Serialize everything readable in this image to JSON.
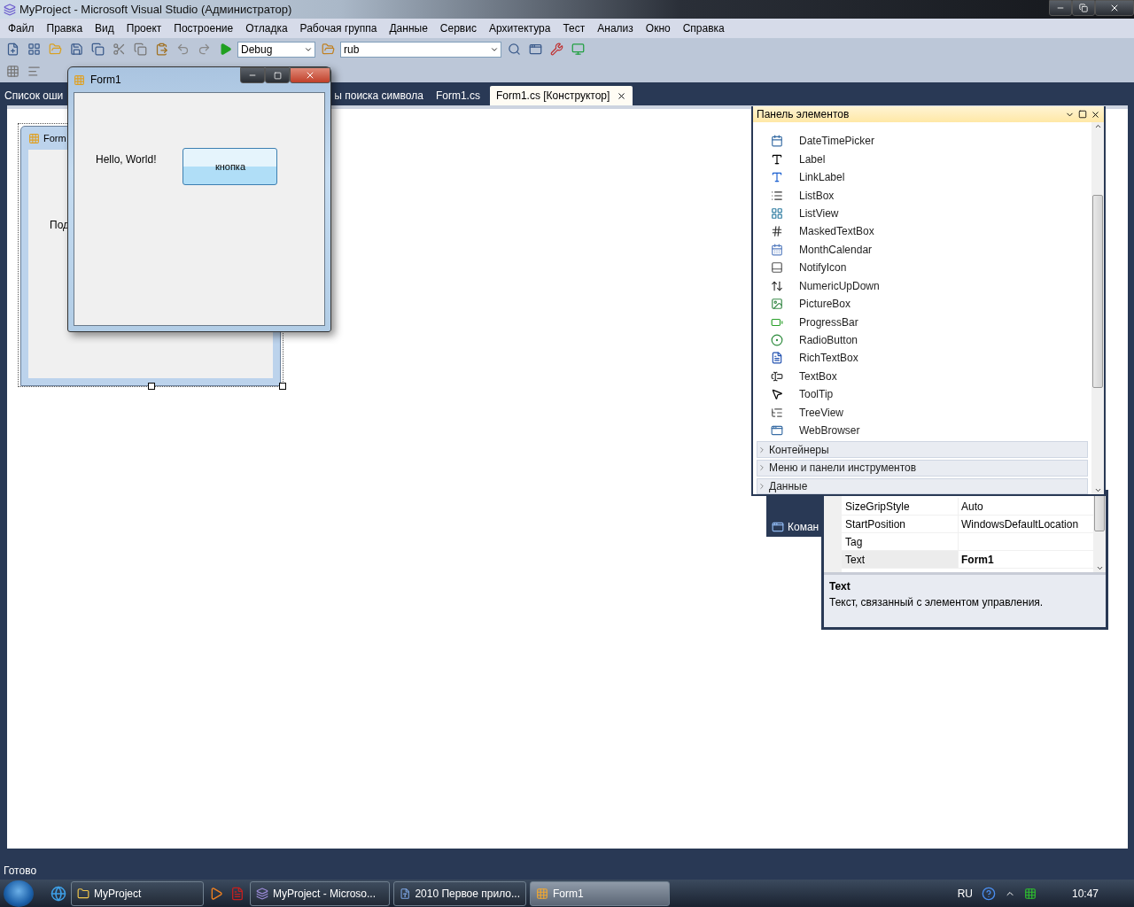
{
  "window": {
    "title": "MyProject - Microsoft Visual Studio (Администратор)"
  },
  "menu": [
    "Файл",
    "Правка",
    "Вид",
    "Проект",
    "Построение",
    "Отладка",
    "Рабочая группа",
    "Данные",
    "Сервис",
    "Архитектура",
    "Тест",
    "Анализ",
    "Окно",
    "Справка"
  ],
  "toolbar": {
    "configuration": "Debug",
    "find_value": "rub"
  },
  "tabs": [
    {
      "label": "Список оши",
      "selected": false
    },
    {
      "label": "ы поиска символа",
      "selected": false
    },
    {
      "label": "Form1.cs",
      "selected": false
    },
    {
      "label": "Form1.cs [Конструктор]",
      "selected": true
    }
  ],
  "designer_form": {
    "title": "Form",
    "label": "Под"
  },
  "running_form": {
    "title": "Form1",
    "label": "Hello, World!",
    "button": "кнопка"
  },
  "toolbox": {
    "title": "Панель элементов",
    "items": [
      {
        "label": "DateTimePicker",
        "kind": "datetime"
      },
      {
        "label": "Label",
        "kind": "label"
      },
      {
        "label": "LinkLabel",
        "kind": "link"
      },
      {
        "label": "ListBox",
        "kind": "list"
      },
      {
        "label": "ListView",
        "kind": "listview"
      },
      {
        "label": "MaskedTextBox",
        "kind": "masked"
      },
      {
        "label": "MonthCalendar",
        "kind": "calendar"
      },
      {
        "label": "NotifyIcon",
        "kind": "notify"
      },
      {
        "label": "NumericUpDown",
        "kind": "updown"
      },
      {
        "label": "PictureBox",
        "kind": "picture"
      },
      {
        "label": "ProgressBar",
        "kind": "progress"
      },
      {
        "label": "RadioButton",
        "kind": "radio"
      },
      {
        "label": "RichTextBox",
        "kind": "richtext"
      },
      {
        "label": "TextBox",
        "kind": "textbox"
      },
      {
        "label": "ToolTip",
        "kind": "tooltip"
      },
      {
        "label": "TreeView",
        "kind": "tree"
      },
      {
        "label": "WebBrowser",
        "kind": "browser"
      }
    ],
    "groups": [
      {
        "label": "Контейнеры",
        "expanded": false
      },
      {
        "label": "Меню и панели инструментов",
        "expanded": false
      },
      {
        "label": "Данные",
        "expanded": false
      }
    ]
  },
  "side_tab": "Коман",
  "properties": {
    "rows": [
      {
        "name": "SizeGripStyle",
        "value": "Auto",
        "selected": false,
        "modified": false
      },
      {
        "name": "StartPosition",
        "value": "WindowsDefaultLocation",
        "selected": false,
        "modified": false
      },
      {
        "name": "Tag",
        "selected": false
      },
      {
        "name": "Text",
        "value": "Form1",
        "selected": true,
        "modified": true
      }
    ],
    "description": {
      "title": "Text",
      "text": "Текст, связанный с элементом управления."
    }
  },
  "status_bar": "Готово",
  "taskbar": {
    "buttons": [
      {
        "label": "MyProject",
        "kind": "folder",
        "selected": false
      },
      {
        "label": "MyProject - Microso...",
        "kind": "vs",
        "selected": false
      },
      {
        "label": "2010 Первое прило...",
        "kind": "word",
        "selected": false
      },
      {
        "label": "Form1",
        "kind": "form",
        "selected": true
      }
    ],
    "language": "RU",
    "clock": "10:47"
  }
}
